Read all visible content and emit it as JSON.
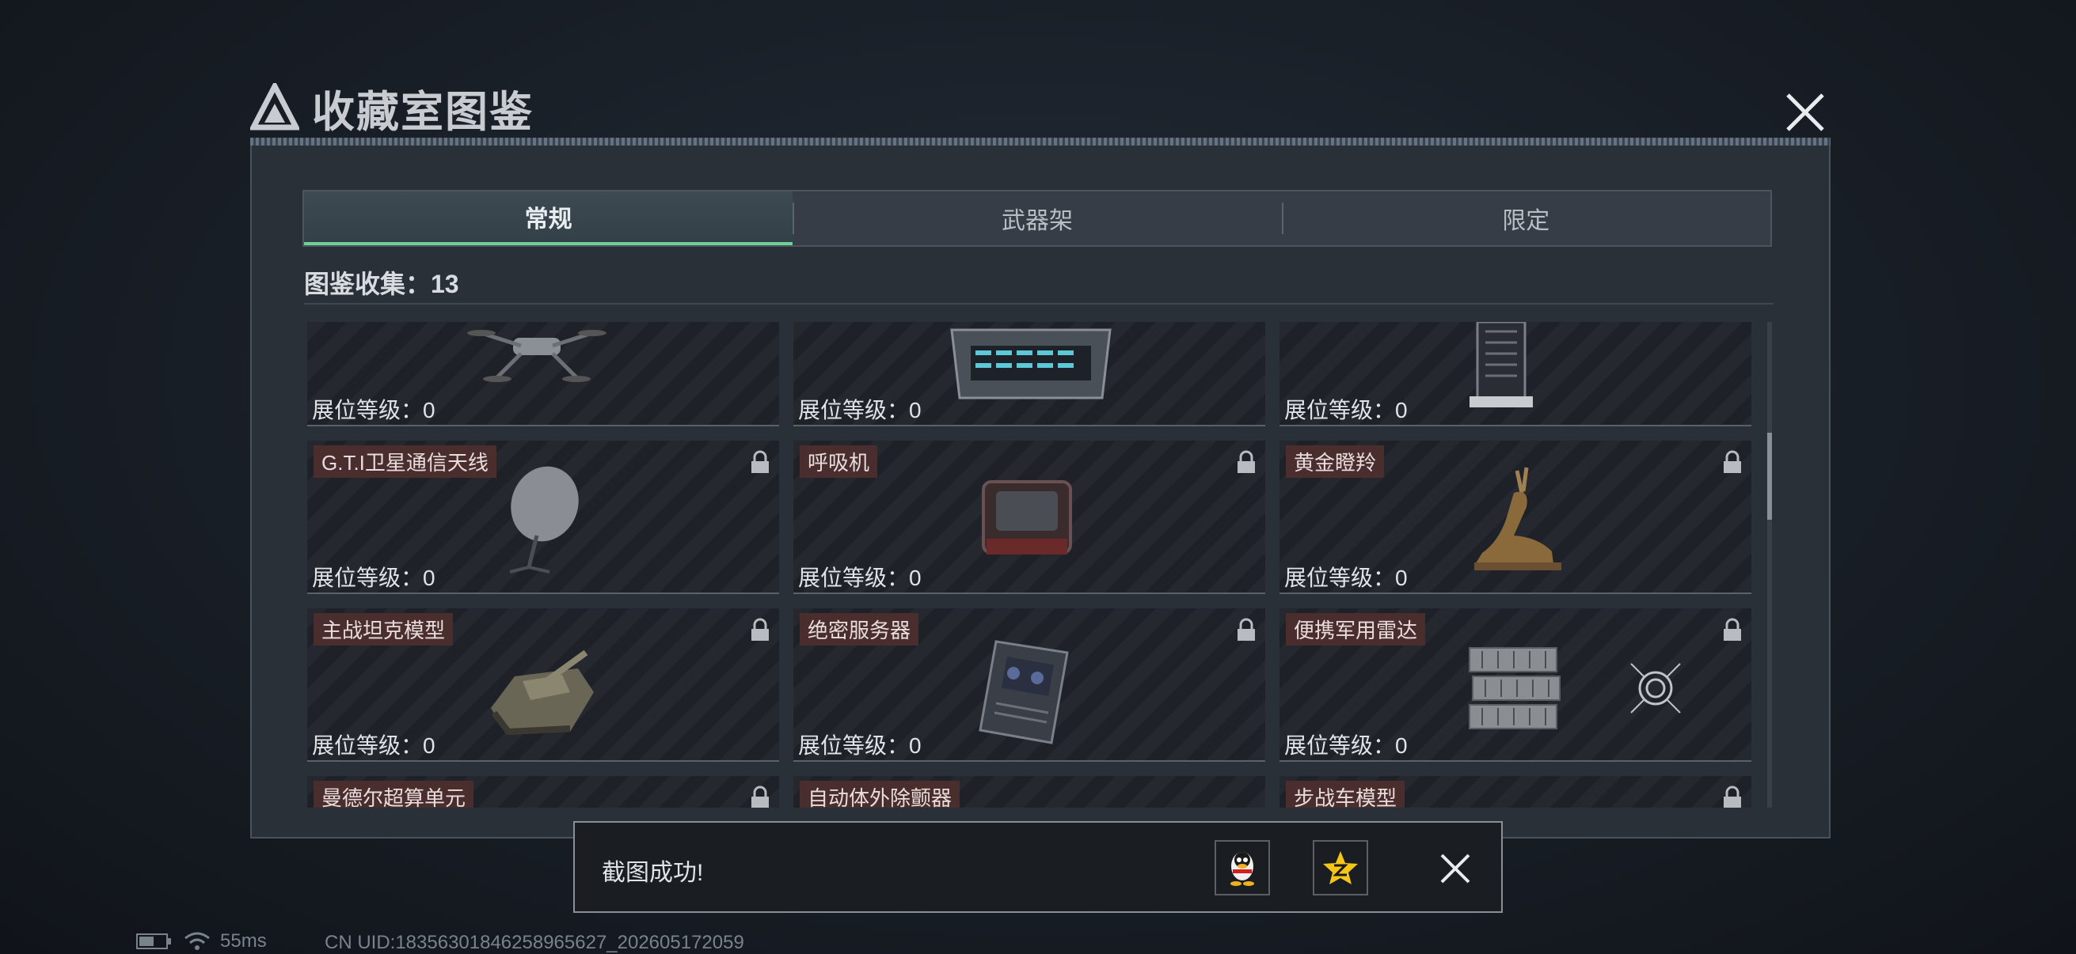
{
  "title": "收藏室图鉴",
  "tabs": [
    {
      "label": "常规",
      "active": true
    },
    {
      "label": "武器架",
      "active": false
    },
    {
      "label": "限定",
      "active": false
    }
  ],
  "collection_count": "图鉴收集：13",
  "level_label": "展位等级：0",
  "items": [
    {
      "name": "",
      "icon": "drone-icon",
      "locked": false
    },
    {
      "name": "",
      "icon": "server-box-icon",
      "locked": false
    },
    {
      "name": "",
      "icon": "server-tower-icon",
      "locked": false
    },
    {
      "name": "G.T.I卫星通信天线",
      "icon": "satellite-dish-icon",
      "locked": true
    },
    {
      "name": "呼吸机",
      "icon": "ventilator-icon",
      "locked": true
    },
    {
      "name": "黄金瞪羚",
      "icon": "golden-gazelle-icon",
      "locked": true
    },
    {
      "name": "主战坦克模型",
      "icon": "tank-model-icon",
      "locked": true
    },
    {
      "name": "绝密服务器",
      "icon": "secret-server-icon",
      "locked": true
    },
    {
      "name": "便携军用雷达",
      "icon": "portable-radar-icon",
      "locked": true
    },
    {
      "name": "曼德尔超算单元",
      "icon": "supercomputer-unit-icon",
      "locked": true
    },
    {
      "name": "自动体外除颤器",
      "icon": "defibrillator-icon",
      "locked": true
    },
    {
      "name": "步战车模型",
      "icon": "ifv-model-icon",
      "locked": true
    }
  ],
  "toast": {
    "message": "截图成功!"
  },
  "status": {
    "ping": "55ms",
    "uid": "CN UID:18356301846258965627_202605172059"
  },
  "colors": {
    "accent": "#6fcf97",
    "name_tag": "#4a2e2e",
    "panel": "#2a3038"
  }
}
